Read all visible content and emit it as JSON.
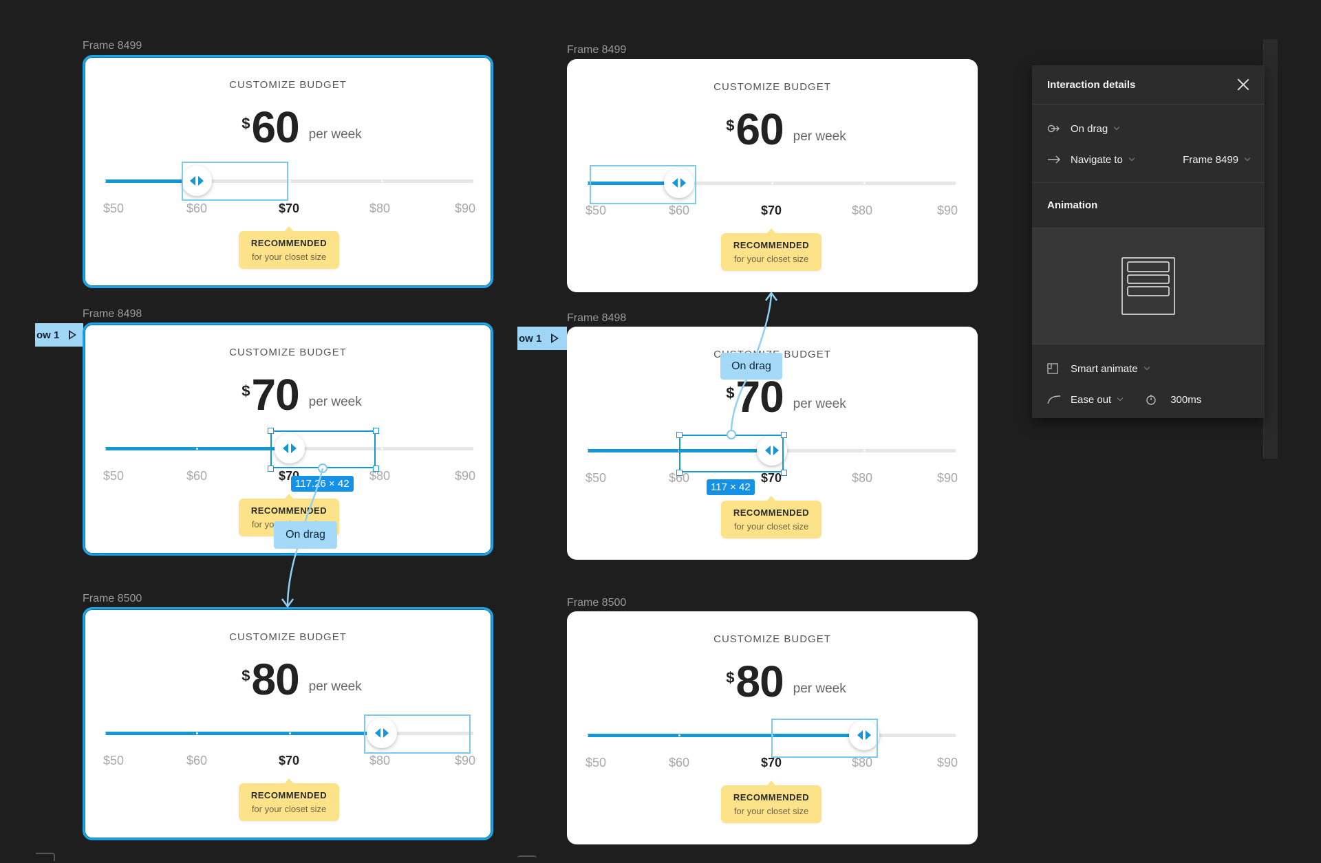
{
  "canvas": {
    "flow_tag_label": "ow 1",
    "left_column": [
      {
        "frame_label": "Frame 8499",
        "title": "CUSTOMIZE BUDGET",
        "currency": "$",
        "amount": "60",
        "period": "per week",
        "value": 60,
        "selected": true
      },
      {
        "frame_label": "Frame 8498",
        "title": "CUSTOMIZE BUDGET",
        "currency": "$",
        "amount": "70",
        "period": "per week",
        "value": 70,
        "selected": true
      },
      {
        "frame_label": "Frame 8500",
        "title": "CUSTOMIZE BUDGET",
        "currency": "$",
        "amount": "80",
        "period": "per week",
        "value": 80,
        "selected": true
      }
    ],
    "right_column": [
      {
        "frame_label": "Frame 8499",
        "title": "CUSTOMIZE BUDGET",
        "currency": "$",
        "amount": "60",
        "period": "per week",
        "value": 60
      },
      {
        "frame_label": "Frame 8498",
        "title": "CUSTOMIZE BUDGET",
        "currency": "$",
        "amount": "70",
        "period": "per week",
        "value": 70
      },
      {
        "frame_label": "Frame 8500",
        "title": "CUSTOMIZE BUDGET",
        "currency": "$",
        "amount": "80",
        "period": "per week",
        "value": 80
      }
    ],
    "slider": {
      "min": 50,
      "max": 90,
      "ticks": [
        "$50",
        "$60",
        "$70",
        "$80",
        "$90"
      ],
      "recommended_tick": "$70",
      "badge_title": "RECOMMENDED",
      "badge_subtitle": "for your closet size"
    },
    "left_size_label": "117.26 × 42",
    "right_size_label": "117 × 42",
    "connector_label": "On drag",
    "colors": {
      "accent": "#1597d6",
      "badge": "#fce38a",
      "selection": "#1aa3e6",
      "flow": "#a5d9f8"
    }
  },
  "panel": {
    "title": "Interaction details",
    "trigger": "On drag",
    "action": "Navigate to",
    "destination": "Frame 8499",
    "animation_title": "Animation",
    "animation_type": "Smart animate",
    "easing": "Ease out",
    "duration": "300ms"
  }
}
